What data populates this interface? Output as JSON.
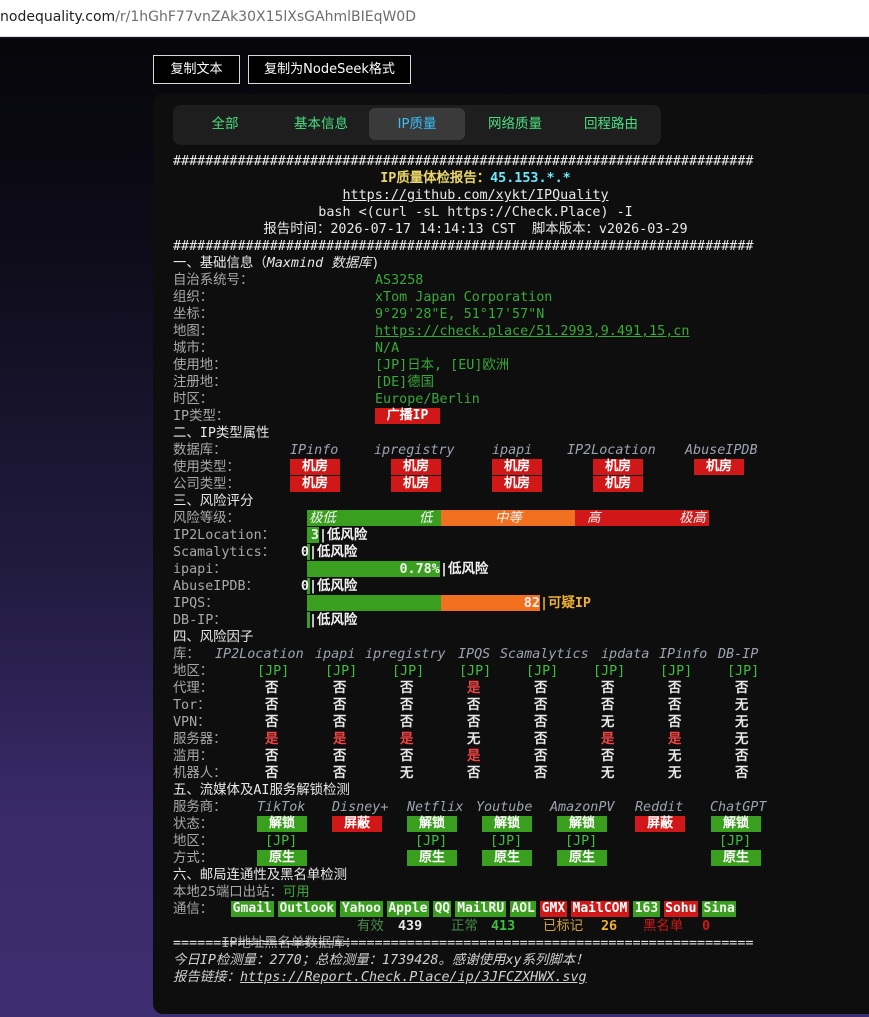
{
  "url": {
    "host": "nodequality.com",
    "path": "/r/1hGhF77vnZAk30X15lXsGAhmlBIEqW0D"
  },
  "buttons": {
    "copy_text": "复制文本",
    "copy_nodeseek": "复制为NodeSeek格式"
  },
  "tabs": [
    {
      "label": "全部"
    },
    {
      "label": "基本信息"
    },
    {
      "label": "IP质量",
      "active": true
    },
    {
      "label": "网络质量"
    },
    {
      "label": "回程路由"
    }
  ],
  "report": {
    "hashline": "########################################################################",
    "title_prefix": "IP质量体检报告：",
    "title_ip": "45.153.*.*",
    "repo_url": "https://github.com/xykt/IPQuality",
    "command": "bash <(curl -sL https://Check.Place) -I",
    "report_time": "报告时间：2026-07-17 14:14:13 CST  脚本版本：v2026-03-29",
    "sec1_prefix": "一、基础信息（",
    "sec1_db": "Maxmind 数据库",
    "basic": [
      {
        "label": "自治系统号：",
        "value": "AS3258"
      },
      {
        "label": "组织：",
        "value": "xTom Japan Corporation"
      },
      {
        "label": "坐标：",
        "value": "9°29'28\"E, 51°17'57\"N"
      },
      {
        "label": "地图：",
        "value": "https://check.place/51.2993,9.491,15,cn"
      },
      {
        "label": "城市：",
        "value": "N/A"
      },
      {
        "label": "使用地：",
        "value": "[JP]日本, [EU]欧洲"
      },
      {
        "label": "注册地：",
        "value": "[DE]德国"
      },
      {
        "label": "时区：",
        "value": "Europe/Berlin"
      },
      {
        "label": "IP类型：",
        "value": "广播IP"
      }
    ],
    "sec2": "二、IP类型属性",
    "type_db_label": "数据库：",
    "type_dbs": [
      "IPinfo",
      "ipregistry",
      "ipapi",
      "IP2Location",
      "AbuseIPDB"
    ],
    "usage_label": "使用类型：",
    "usage": [
      "机房",
      "机房",
      "机房",
      "机房",
      "机房"
    ],
    "company_label": "公司类型：",
    "company": [
      "机房",
      "机房",
      "机房",
      "机房"
    ],
    "sec3": "三、风险评分",
    "risk_level_label": "风险等级：",
    "risk_levels": [
      "极低",
      "低",
      "中等",
      "高",
      "极高"
    ],
    "scores": [
      {
        "label": "IP2Location：",
        "value": "3",
        "text": "|低风险",
        "level": "low",
        "fraction": 0.03
      },
      {
        "label": "Scamalytics：",
        "value": "0",
        "text": "|低风险",
        "level": "low",
        "fraction": 0.0
      },
      {
        "label": "ipapi：",
        "value": "0.78%",
        "text": "|低风险",
        "level": "low",
        "fraction": 0.33
      },
      {
        "label": "AbuseIPDB：",
        "value": "0",
        "text": "|低风险",
        "level": "low",
        "fraction": 0.0
      },
      {
        "label": "IPQS：",
        "value": "82",
        "text": "|可疑IP",
        "level": "mid",
        "fraction": 0.58
      },
      {
        "label": "DB-IP：",
        "value": "",
        "text": "|低风险",
        "level": "low",
        "fraction": 0.0
      }
    ],
    "sec4": "四、风险因子",
    "factor_db_label": "库：",
    "factor_dbs": [
      "IP2Location",
      "ipapi",
      "ipregistry",
      "IPQS",
      "Scamalytics",
      "ipdata",
      "IPinfo",
      "DB-IP"
    ],
    "factors": [
      {
        "label": "地区：",
        "values": [
          "[JP]",
          "[JP]",
          "[JP]",
          "[JP]",
          "[JP]",
          "[JP]",
          "[JP]",
          "[JP]"
        ]
      },
      {
        "label": "代理：",
        "values": [
          "否",
          "否",
          "否",
          "是",
          "否",
          "否",
          "否",
          "否"
        ]
      },
      {
        "label": "Tor：",
        "values": [
          "否",
          "否",
          "否",
          "否",
          "否",
          "否",
          "否",
          "无"
        ]
      },
      {
        "label": "VPN：",
        "values": [
          "否",
          "否",
          "否",
          "否",
          "否",
          "无",
          "否",
          "无"
        ]
      },
      {
        "label": "服务器：",
        "values": [
          "是",
          "是",
          "是",
          "无",
          "否",
          "是",
          "是",
          "无"
        ]
      },
      {
        "label": "滥用：",
        "values": [
          "否",
          "否",
          "否",
          "是",
          "否",
          "否",
          "无",
          "否"
        ]
      },
      {
        "label": "机器人：",
        "values": [
          "否",
          "否",
          "无",
          "否",
          "否",
          "无",
          "无",
          "否"
        ]
      }
    ],
    "sec5": "五、流媒体及AI服务解锁检测",
    "svc_label": "服务商：",
    "services": [
      "TikTok",
      "Disney+",
      "Netflix",
      "Youtube",
      "AmazonPV",
      "Reddit",
      "ChatGPT"
    ],
    "status_label": "状态：",
    "status": [
      "解锁",
      "屏蔽",
      "解锁",
      "解锁",
      "解锁",
      "屏蔽",
      "解锁"
    ],
    "region_label": "地区：",
    "regions": [
      "[JP]",
      "",
      "[JP]",
      "[JP]",
      "[JP]",
      "",
      "[JP]"
    ],
    "method_label": "方式：",
    "methods": [
      "原生",
      "",
      "原生",
      "原生",
      "原生",
      "",
      "原生"
    ],
    "sec6": "六、邮局连通性及黑名单检测",
    "port25_label": "本地25端口出站：",
    "port25_value": "可用",
    "mail_label": "通信：",
    "mail": [
      {
        "name": "Gmail",
        "ok": true
      },
      {
        "name": "Outlook",
        "ok": true
      },
      {
        "name": "Yahoo",
        "ok": true
      },
      {
        "name": "Apple",
        "ok": true
      },
      {
        "name": "QQ",
        "ok": true
      },
      {
        "name": "MailRU",
        "ok": true
      },
      {
        "name": "AOL",
        "ok": true
      },
      {
        "name": "GMX",
        "ok": false
      },
      {
        "name": "MailCOM",
        "ok": false
      },
      {
        "name": "163",
        "ok": true
      },
      {
        "name": "Sohu",
        "ok": false
      },
      {
        "name": "Sina",
        "ok": true
      }
    ],
    "bl_label": "IP地址黑名单数据库：",
    "bl": {
      "valid_label": "有效",
      "valid": "439",
      "normal_label": "正常",
      "normal": "413",
      "marked_label": "已标记",
      "marked": "26",
      "black_label": "黑名单",
      "black": "0"
    },
    "eqline": "========================================================================",
    "footer1": "今日IP检测量：2770；总检测量：1739428。感谢使用xy系列脚本！",
    "footer2_prefix": "报告链接：",
    "footer2_url": "https://Report.Check.Place/ip/3JFCZXHWX.svg"
  },
  "colors": {
    "green": "#3a9f1f",
    "red": "#d01818",
    "orange": "#f07020",
    "link": "#3aa83a"
  }
}
